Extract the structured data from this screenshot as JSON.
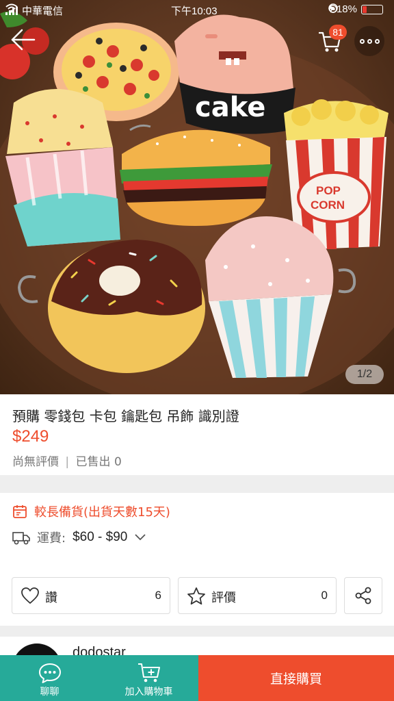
{
  "status_bar": {
    "carrier": "中華電信",
    "time": "下午10:03",
    "battery": "18%"
  },
  "header": {
    "cart_count": "81"
  },
  "gallery": {
    "counter": "1/2",
    "cake_text": "cake",
    "popcorn_line1": "POP",
    "popcorn_line2": "CORN"
  },
  "product": {
    "title": "預購 零錢包 卡包 鑰匙包 吊飾 識別證",
    "price": "$249",
    "rating_text": "尚無評價",
    "sold_text": "已售出 0"
  },
  "preorder": {
    "text": "較長備貨(出貨天數15天)"
  },
  "shipping": {
    "label": "運費:",
    "value": "$60 - $90"
  },
  "actions": {
    "like_label": "讚",
    "like_count": "6",
    "review_label": "評價",
    "review_count": "0"
  },
  "seller": {
    "name": "dodostar"
  },
  "bottom_bar": {
    "chat_label": "聊聊",
    "cart_label": "加入購物車",
    "buy_label": "直接購買"
  },
  "colors": {
    "accent": "#ee4d2d",
    "teal": "#26aa99"
  }
}
